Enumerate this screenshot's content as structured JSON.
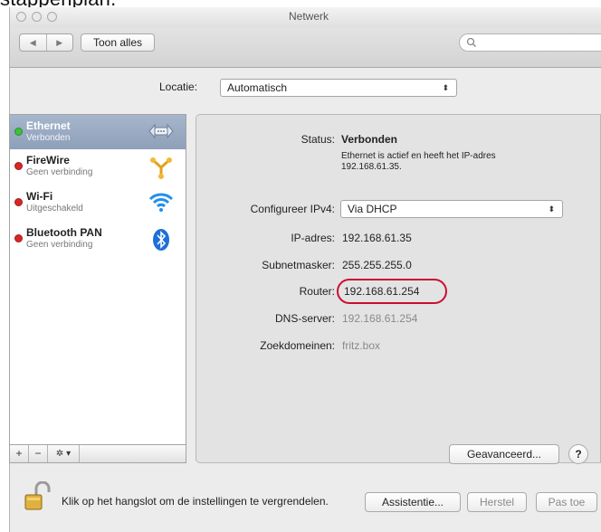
{
  "caption": "stappenplan.",
  "window": {
    "title": "Netwerk"
  },
  "toolbar": {
    "back_glyph": "◀",
    "forward_glyph": "▶",
    "show_all_label": "Toon alles",
    "search_placeholder": ""
  },
  "location": {
    "label": "Locatie:",
    "value": "Automatisch"
  },
  "services": [
    {
      "name": "Ethernet",
      "status": "Verbonden",
      "status_color": "#3cc23c",
      "icon": "ethernet-icon",
      "selected": true
    },
    {
      "name": "FireWire",
      "status": "Geen verbinding",
      "status_color": "#d82626",
      "icon": "firewire-icon",
      "selected": false
    },
    {
      "name": "Wi-Fi",
      "status": "Uitgeschakeld",
      "status_color": "#d82626",
      "icon": "wifi-icon",
      "selected": false
    },
    {
      "name": "Bluetooth PAN",
      "status": "Geen verbinding",
      "status_color": "#d82626",
      "icon": "bluetooth-icon",
      "selected": false
    }
  ],
  "sidebar_tools": {
    "add": "+",
    "remove": "−",
    "gear": "✲ ▾"
  },
  "details": {
    "status_label": "Status:",
    "status_value": "Verbonden",
    "status_description_line1": "Ethernet is actief en heeft het IP-adres",
    "status_description_line2": "192.168.61.35.",
    "configure_label": "Configureer IPv4:",
    "configure_value": "Via DHCP",
    "ip_label": "IP-adres:",
    "ip_value": "192.168.61.35",
    "subnet_label": "Subnetmasker:",
    "subnet_value": "255.255.255.0",
    "router_label": "Router:",
    "router_value": "192.168.61.254",
    "dns_label": "DNS-server:",
    "dns_value": "192.168.61.254",
    "search_domains_label": "Zoekdomeinen:",
    "search_domains_value": "fritz.box"
  },
  "buttons": {
    "advanced": "Geavanceerd...",
    "help": "?",
    "assist": "Assistentie...",
    "revert": "Herstel",
    "apply": "Pas toe"
  },
  "lock_text": "Klik op het hangslot om de instellingen te vergrendelen.",
  "colors": {
    "selection": "#97a8c0",
    "highlight_ring": "#c8102e",
    "accent_blue": "#1f8ff0"
  }
}
